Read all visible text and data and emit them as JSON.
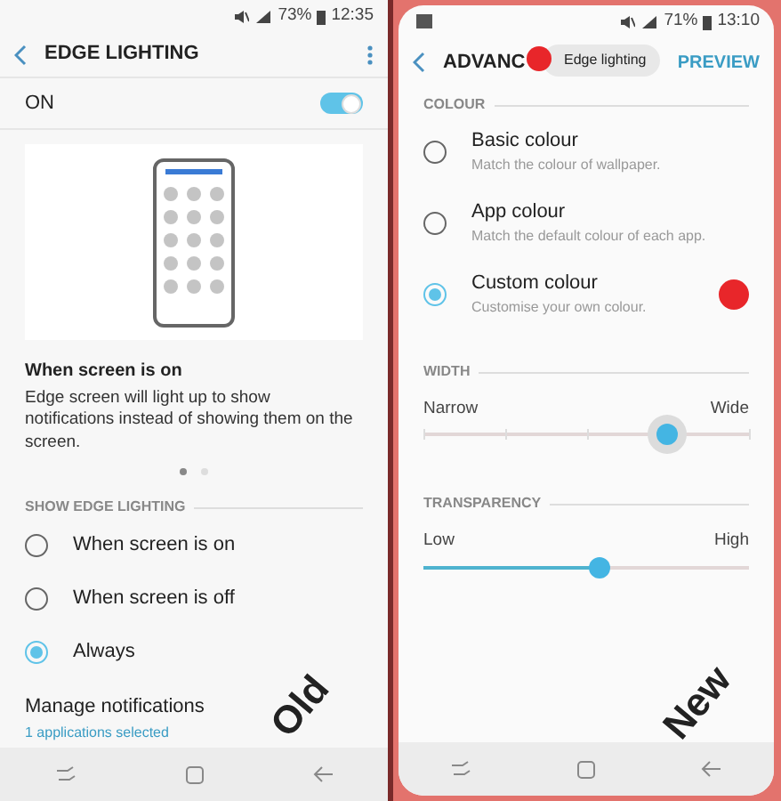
{
  "old": {
    "label": "Old",
    "status_bar": {
      "battery": "73%",
      "time": "12:35"
    },
    "title": "EDGE LIGHTING",
    "master": {
      "label": "ON",
      "on": true
    },
    "caption": {
      "title": "When screen is on",
      "text": "Edge screen will light up to show notifications instead of showing them on the screen."
    },
    "pager": [
      {
        "selected": true
      },
      {
        "selected": false
      }
    ],
    "section": "SHOW EDGE LIGHTING",
    "options": [
      {
        "label": "When screen is on",
        "selected": false
      },
      {
        "label": "When screen is off",
        "selected": false
      },
      {
        "label": "Always",
        "selected": true
      }
    ],
    "manage": {
      "title": "Manage notifications",
      "subtitle": "1 applications selected"
    }
  },
  "new": {
    "label": "New",
    "status_bar": {
      "battery": "71%",
      "time": "13:10"
    },
    "title": "ADVANC",
    "toast": "Edge lighting",
    "action": "PREVIEW",
    "colour_section": "COLOUR",
    "colours": [
      {
        "title": "Basic colour",
        "subtitle": "Match the colour of wallpaper.",
        "selected": false
      },
      {
        "title": "App colour",
        "subtitle": "Match the default colour of each app.",
        "selected": false
      },
      {
        "title": "Custom colour",
        "subtitle": "Customise your own colour.",
        "selected": true,
        "color": "#e8262a"
      }
    ],
    "width": {
      "section": "WIDTH",
      "min_label": "Narrow",
      "max_label": "Wide",
      "level": 0.75
    },
    "transparency": {
      "section": "TRANSPARENCY",
      "min_label": "Low",
      "max_label": "High",
      "level": 0.54
    }
  }
}
